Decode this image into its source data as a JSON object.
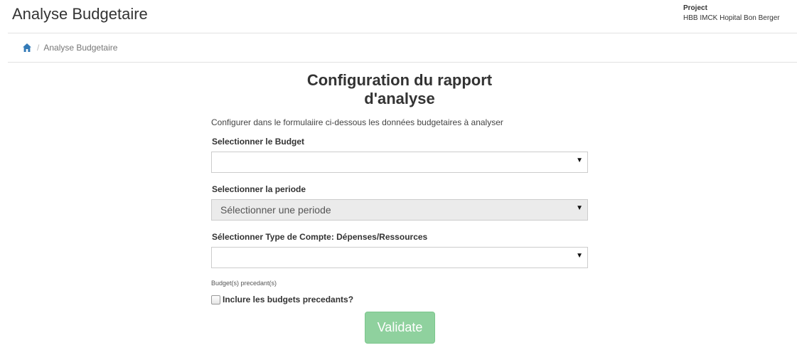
{
  "header": {
    "title": "Analyse Budgetaire",
    "project_label": "Project",
    "project_name": "HBB IMCK Hopital Bon Berger"
  },
  "breadcrumb": {
    "home_icon": "home-icon",
    "current": "Analyse Budgetaire"
  },
  "form": {
    "title": "Configuration du rapport d'analyse",
    "description": "Configurer dans le formulaiire ci-dessous les données budgetaires à analyser",
    "budget_label": "Selectionner le Budget",
    "budget_value": "",
    "period_label": "Selectionner la periode",
    "period_value": "Sélectionner une periode",
    "account_type_label": "Sélectionner Type de Compte: Dépenses/Ressources",
    "account_type_value": "",
    "previous_budgets_label": "Budget(s) precedant(s)",
    "include_previous_label": "Inclure les budgets precedants?",
    "include_previous_checked": false,
    "validate_label": "Validate"
  },
  "colors": {
    "validate_button": "#8fd19e",
    "home_icon": "#337ab7",
    "disabled_select": "#ebebeb"
  }
}
